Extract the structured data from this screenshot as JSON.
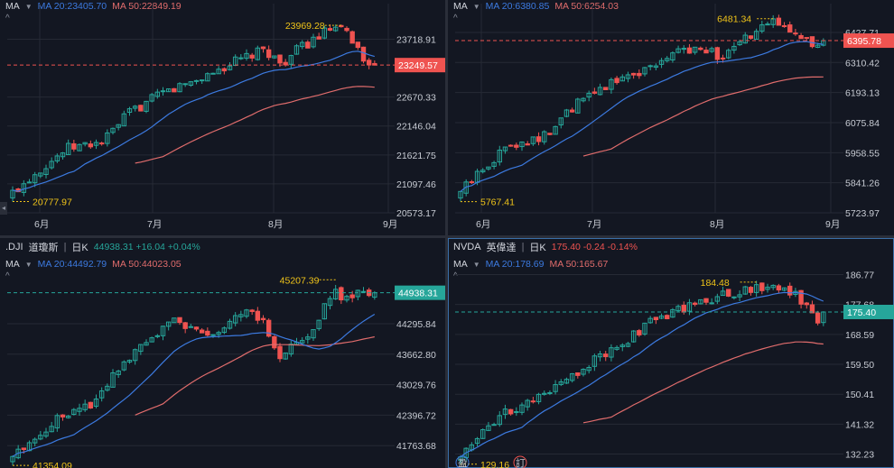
{
  "colors": {
    "background": "#131722",
    "up": "#26a69a",
    "down": "#ef5350",
    "ma20": "#3c7ae0",
    "ma50": "#e06c6c",
    "grid": "#262a35",
    "marker": "#f0c419",
    "last_down": "#ef5350",
    "last_up": "#26a69a"
  },
  "panels": [
    {
      "id": "tl",
      "symbol": "",
      "name": "",
      "period": "",
      "quote": "",
      "ma_label": "MA",
      "ma20_text": "MA 20:23405.70",
      "ma50_text": "MA 50:22849.19",
      "price_labels": [
        "23718.91",
        "22670.33",
        "22146.04",
        "21621.75",
        "21097.46",
        "20573.17"
      ],
      "last_price": "23249.57",
      "last_dir": "down",
      "high_marker": "23969.28",
      "low_marker": "20777.97",
      "month_labels": [
        "6月",
        "7月",
        "8月",
        "9月"
      ],
      "chart_data": {
        "type": "candlestick",
        "ylim": [
          20573.17,
          24200
        ],
        "first": 20777.97,
        "high": 23969.28,
        "last": 23249.57,
        "ma20_last": 23405.7,
        "ma50_last": 22849.19,
        "shape": "nasdaq"
      }
    },
    {
      "id": "tr",
      "symbol": "",
      "name": "",
      "period": "",
      "quote": "",
      "ma_label": "MA",
      "ma20_text": "MA 20:6380.85",
      "ma50_text": "MA 50:6254.03",
      "price_labels": [
        "6427.71",
        "6310.42",
        "6193.13",
        "6075.84",
        "5958.55",
        "5841.26",
        "5723.97"
      ],
      "last_price": "6395.78",
      "last_dir": "down",
      "high_marker": "6481.34",
      "low_marker": "5767.41",
      "month_labels": [
        "6月",
        "7月",
        "8月",
        "9月"
      ],
      "chart_data": {
        "type": "candlestick",
        "ylim": [
          5723.97,
          6505
        ],
        "first": 5767.41,
        "high": 6481.34,
        "last": 6395.78,
        "ma20_last": 6380.85,
        "ma50_last": 6254.03,
        "shape": "spx"
      }
    },
    {
      "id": "bl",
      "symbol": ".DJI",
      "name": "道瓊斯",
      "period": "日K",
      "quote": "44938.31 +16.04 +0.04%",
      "ma_label": "MA",
      "ma20_text": "MA 20:44492.79",
      "ma50_text": "MA 50:44023.05",
      "price_labels": [
        "44295.84",
        "43662.80",
        "43029.76",
        "42396.72",
        "41763.68"
      ],
      "last_price": "44938.31",
      "last_dir": "up",
      "high_marker": "45207.39",
      "low_marker": "41354.09",
      "month_labels": [],
      "chart_data": {
        "type": "candlestick",
        "ylim": [
          41300,
          45400
        ],
        "first": 41354.09,
        "high": 45207.39,
        "last": 44938.31,
        "ma20_last": 44492.79,
        "ma50_last": 44023.05,
        "shape": "dji"
      }
    },
    {
      "id": "br",
      "symbol": "NVDA",
      "name": "英偉達",
      "period": "日K",
      "quote": "175.40 -0.24 -0.14%",
      "ma_label": "MA",
      "ma20_text": "MA 20:178.69",
      "ma50_text": "MA 50:165.67",
      "price_labels": [
        "186.77",
        "177.68",
        "168.59",
        "159.50",
        "150.41",
        "141.32",
        "132.23"
      ],
      "last_price": "175.40",
      "last_dir": "up",
      "high_marker": "184.48",
      "low_marker": "129.16",
      "month_labels": [],
      "event_markers": [
        "盈",
        "訂"
      ],
      "chart_data": {
        "type": "candlestick",
        "ylim": [
          128,
          188
        ],
        "first": 129.16,
        "high": 184.48,
        "last": 175.4,
        "ma20_last": 178.69,
        "ma50_last": 165.67,
        "shape": "nvda"
      }
    }
  ]
}
